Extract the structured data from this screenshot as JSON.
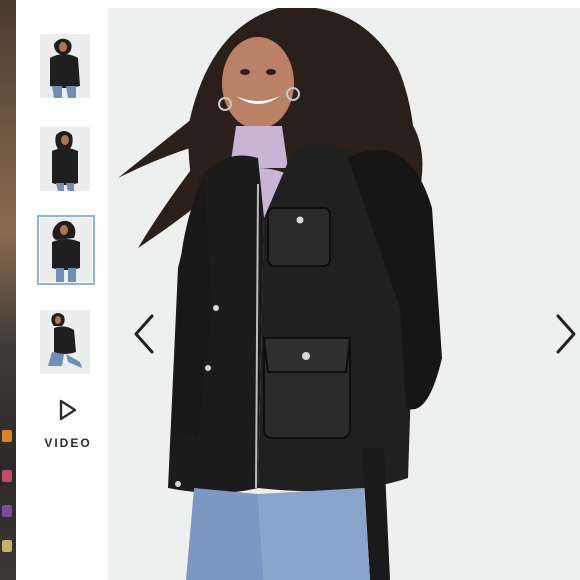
{
  "gallery": {
    "thumbnails": [
      {
        "label": "product-image-1",
        "selected": false
      },
      {
        "label": "product-image-2",
        "selected": false
      },
      {
        "label": "product-image-3",
        "selected": true
      },
      {
        "label": "product-image-4",
        "selected": false
      }
    ],
    "video_label": "VIDEO",
    "video_icon": "play-icon",
    "prev_icon": "chevron-left-icon",
    "next_icon": "chevron-right-icon",
    "selected_outline_color": "#8fb3e8",
    "background_color": "#eef0f0"
  }
}
